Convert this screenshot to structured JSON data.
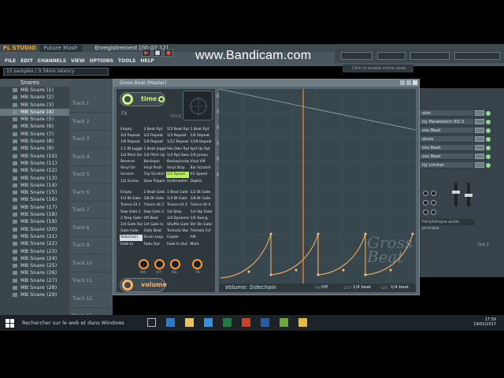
{
  "app": {
    "logo": "FL STUDIO",
    "song": "Future Mash",
    "recording": "Enregistrement [00:02:12]",
    "watermark": "www.Bandicam.com",
    "hint": "Click to enable online news",
    "latency": "15 samples / 0.34ms latency"
  },
  "menu": [
    "FILE",
    "EDIT",
    "CHANNELS",
    "VIEW",
    "OPTIONS",
    "TOOLS",
    "HELP"
  ],
  "browser": {
    "header": "Snares",
    "items": [
      "MB Snare (1)",
      "MB Snare (2)",
      "MB Snare (3)",
      "MB Snare (4)",
      "MB Snare (5)",
      "MB Snare (6)",
      "MB Snare (7)",
      "MB Snare (8)",
      "MB Snare (9)",
      "MB Snare (10)",
      "MB Snare (11)",
      "MB Snare (12)",
      "MB Snare (13)",
      "MB Snare (14)",
      "MB Snare (15)",
      "MB Snare (16)",
      "MB Snare (17)",
      "MB Snare (18)",
      "MB Snare (19)",
      "MB Snare (20)",
      "MB Snare (21)",
      "MB Snare (22)",
      "MB Snare (23)",
      "MB Snare (24)",
      "MB Snare (25)",
      "MB Snare (26)",
      "MB Snare (27)",
      "MB Snare (28)",
      "MB Snare (29)"
    ],
    "selected_index": 3
  },
  "tracks": [
    "Track 1",
    "Track 2",
    "Track 3",
    "Track 4",
    "Track 5",
    "Track 6",
    "Track 7",
    "Track 8",
    "Track 9",
    "Track 10",
    "Track 11",
    "Track 12",
    "Track 13"
  ],
  "mixer": {
    "items": [
      "sion",
      "ity Parametric EQ 2",
      "oss Beat",
      "sinus",
      "oss Beat",
      "oss Beat",
      "ity Limiter"
    ],
    "footer": "Périphérique audio principal",
    "out_label": "Out 2"
  },
  "plugin": {
    "title": "Gross Beat (Master)",
    "time_label": "time",
    "volume_label": "volume",
    "small_label": "FX",
    "hold_label": "HOLD",
    "time_presets": [
      [
        "Empty",
        "2 Beat Rpt",
        "1/3 Beat Rpt",
        "1 Beat Rpt"
      ],
      [
        "3/4 Repeat",
        "1/2 Repeat",
        "1/3 Repeat",
        "1/4 Repeat"
      ],
      [
        "1/6 Repeat",
        "1/8 Repeat",
        "1/12 Repeat",
        "1/16 Repeat"
      ],
      [
        "1.5 Bt Juggle",
        "1 Beat Juggle",
        "Slw Dwn Rpt",
        "Spd Up Rpt"
      ],
      [
        "1/4 Pitch Dn",
        "1/4 Pitch Up",
        "1/4 Rpt Swng",
        "1/4 Jumps"
      ],
      [
        "Reverse",
        "Backspin",
        "Backspinstart",
        "Vinyl Off"
      ],
      [
        "Vinyl On",
        "Vinyl Rvsh",
        "Vinyl Stop",
        "Bar Scratch"
      ],
      [
        "Scratch",
        "Trip Scratch",
        "1/2 Speed",
        "X2 Speed"
      ],
      [
        "1/2 Grains",
        "Slow Trippin",
        "Underwater",
        "Digital"
      ]
    ],
    "time_selected": [
      7,
      2
    ],
    "volume_presets": [
      [
        "Empty",
        "2 Beat Gate",
        "1 Beat Gate",
        "1/2 Bt Gate"
      ],
      [
        "1/3 Bt Gate",
        "3/8 Bt Gate",
        "1/4 Bt Gate",
        "1/8 Bt Gate"
      ],
      [
        "Trance Gt 1",
        "Trance Gt 2",
        "Trance Gt 3",
        "Trance Gt 4"
      ],
      [
        "Saw Gate 1",
        "Saw Gate 2",
        "1st Step",
        "1st Stp Fade"
      ],
      [
        "2 Step Gate",
        "Off Beat",
        "1/4 Dynamic",
        "1/4 Swing"
      ],
      [
        "1/4 Gate Out",
        "1/4 Gate In",
        "Shuffle Gate",
        "Shr Dn Gate"
      ],
      [
        "Gate Fade",
        "Gate Beat",
        "Tremolo Slw",
        "Tremolo Fst"
      ],
      [
        "Sidechain",
        "Drum Loop",
        "Copter",
        "AM"
      ],
      [
        "Fade In",
        "Fade Out",
        "Fade In Out",
        "Mute"
      ]
    ],
    "volume_selected": [
      7,
      0
    ],
    "knob_labels": [
      "MIX",
      "ATT",
      "REL",
      "TN"
    ],
    "footer": {
      "graph_label": "Volume: Sidechain",
      "mix_label": "MIX",
      "mix_value": "Off",
      "step_label": "STEP",
      "step_value": "1/4 beat",
      "len_label": "LEN",
      "len_value": "1/4 beat"
    },
    "logo_text": "Gross Beat"
  },
  "taskbar": {
    "search": "Rechercher sur le web et dans Windows",
    "time": "17:59",
    "date": "19/02/2017"
  },
  "colors": {
    "accent_green": "#b7ef5c",
    "accent_orange": "#ffb264",
    "curve": "#e9a45c",
    "playhead": "#ff8a30"
  }
}
